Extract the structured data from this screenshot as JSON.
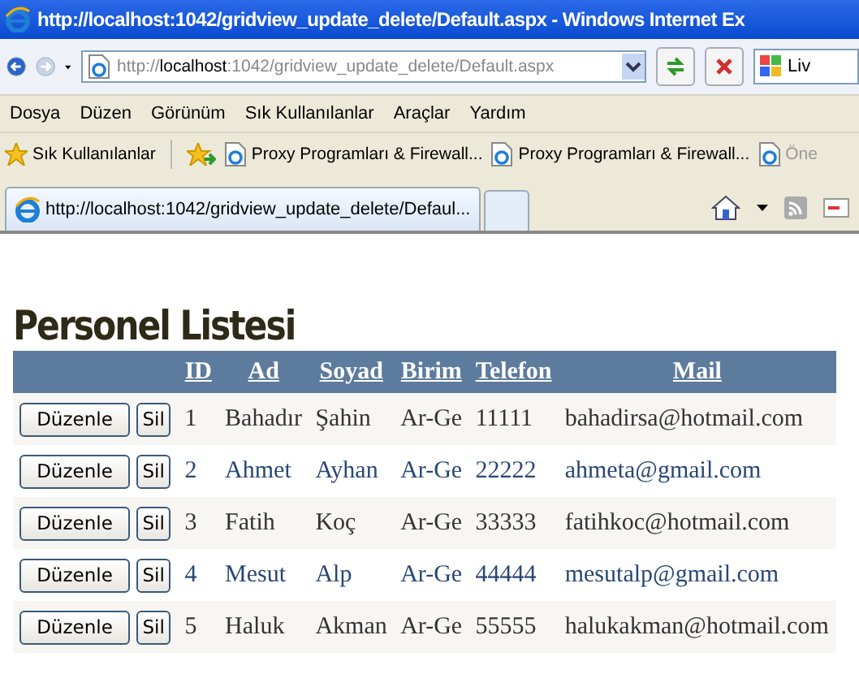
{
  "window": {
    "title": "http://localhost:1042/gridview_update_delete/Default.aspx - Windows Internet Ex"
  },
  "address_bar": {
    "scheme": "http://",
    "host": "localhost",
    "path": ":1042/gridview_update_delete/Default.aspx"
  },
  "search_field": {
    "value": "Liv"
  },
  "menu": [
    "Dosya",
    "Düzen",
    "Görünüm",
    "Sık Kullanılanlar",
    "Araçlar",
    "Yardım"
  ],
  "favorites_bar": {
    "favorites_button": "Sık Kullanılanlar",
    "links": [
      {
        "label": "Proxy Programları & Firewall...",
        "disabled": false
      },
      {
        "label": "Proxy Programları & Firewall...",
        "disabled": false
      },
      {
        "label": "Öne",
        "disabled": true
      }
    ]
  },
  "tabs": [
    {
      "label": "http://localhost:1042/gridview_update_delete/Defaul...",
      "selected": true
    }
  ],
  "page": {
    "heading": "Personel Listesi",
    "table": {
      "columns": [
        "ID",
        "Ad",
        "Soyad",
        "Birim",
        "Telefon",
        "Mail"
      ],
      "rows": [
        {
          "edit": "Düzenle",
          "delete": "Sil",
          "alternate": false,
          "cells": [
            "1",
            "Bahadır",
            "Şahin",
            "Ar-Ge",
            "11111",
            "bahadirsa@hotmail.com"
          ]
        },
        {
          "edit": "Düzenle",
          "delete": "Sil",
          "alternate": true,
          "cells": [
            "2",
            "Ahmet",
            "Ayhan",
            "Ar-Ge",
            "22222",
            "ahmeta@gmail.com"
          ]
        },
        {
          "edit": "Düzenle",
          "delete": "Sil",
          "alternate": false,
          "cells": [
            "3",
            "Fatih",
            "Koç",
            "Ar-Ge",
            "33333",
            "fatihkoc@hotmail.com"
          ]
        },
        {
          "edit": "Düzenle",
          "delete": "Sil",
          "alternate": true,
          "cells": [
            "4",
            "Mesut",
            "Alp",
            "Ar-Ge",
            "44444",
            "mesutalp@gmail.com"
          ]
        },
        {
          "edit": "Düzenle",
          "delete": "Sil",
          "alternate": false,
          "cells": [
            "5",
            "Haluk",
            "Akman",
            "Ar-Ge",
            "55555",
            "halukakman@hotmail.com"
          ]
        }
      ]
    }
  }
}
